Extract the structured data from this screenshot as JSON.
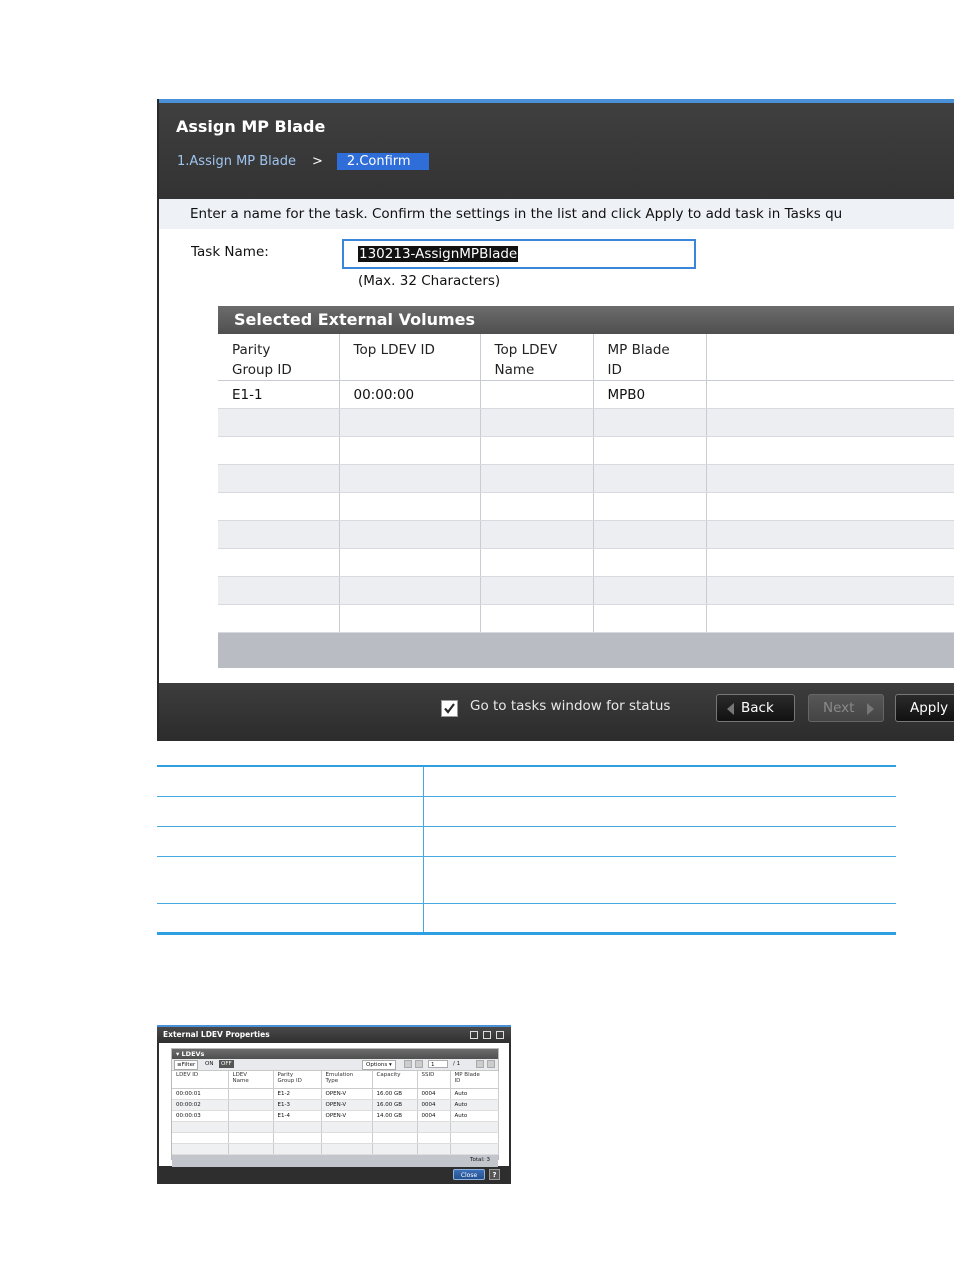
{
  "dialog": {
    "title": "Assign MP Blade",
    "steps": {
      "step1": "1.Assign MP Blade",
      "separator": ">",
      "step2": "2.Confirm"
    },
    "instruction": "Enter a name for the task. Confirm the settings in the list and click Apply to add task in Tasks qu",
    "task_name": {
      "label": "Task Name:",
      "value": "130213-AssignMPBlade",
      "hint": "(Max. 32 Characters)"
    },
    "panel_title": "Selected External Volumes",
    "table": {
      "columns": [
        "Parity\nGroup ID",
        "Top LDEV ID",
        "Top LDEV\nName",
        "MP Blade\nID",
        ""
      ],
      "rows": [
        [
          "E1-1",
          "00:00:00",
          "",
          "MPB0",
          ""
        ]
      ]
    },
    "footer": {
      "checkbox_label": "Go to tasks window for status",
      "checkbox_checked": true,
      "back_label": "Back",
      "next_label": "Next",
      "apply_label": "Apply"
    }
  },
  "ext_ldev": {
    "title": "External LDEV Properties",
    "panel_title": "LDEVs",
    "filter_label": "Filter",
    "on_label": "ON",
    "off_label": "OFF",
    "options_label": "Options",
    "page_value": "1",
    "page_total": "/ 1",
    "columns": [
      "LDEV ID",
      "LDEV\nName",
      "Parity\nGroup ID",
      "Emulation\nType",
      "Capacity",
      "SSID",
      "MP Blade\nID"
    ],
    "rows": [
      [
        "00:00:01",
        "",
        "E1-2",
        "OPEN-V",
        "16.00 GB",
        "0004",
        "Auto"
      ],
      [
        "00:00:02",
        "",
        "E1-3",
        "OPEN-V",
        "16.00 GB",
        "0004",
        "Auto"
      ],
      [
        "00:00:03",
        "",
        "E1-4",
        "OPEN-V",
        "14.00 GB",
        "0004",
        "Auto"
      ]
    ],
    "total_label": "Total:",
    "total_value": "3",
    "close_label": "Close",
    "help_label": "?"
  }
}
